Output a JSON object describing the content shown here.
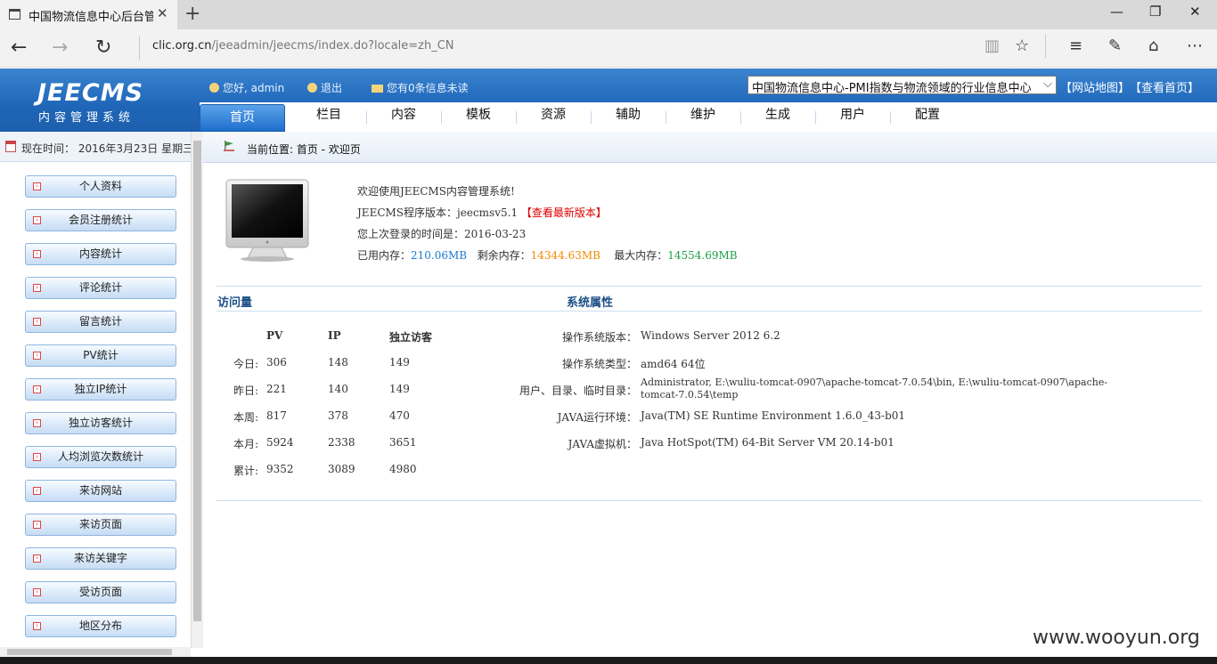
{
  "browser": {
    "tab_title": "中国物流信息中心后台管",
    "new_tab": "+",
    "url_host": "clic.org.cn",
    "url_path": "/jeeadmin/jeecms/index.do?locale=zh_CN",
    "window_controls": [
      "minimize-icon",
      "restore-icon",
      "close-icon"
    ],
    "toolbar_icons": [
      "reading-view-icon",
      "favorite-star-icon",
      "hub-icon",
      "web-note-icon",
      "share-icon",
      "more-icon"
    ]
  },
  "header": {
    "logo_main": "JEECMS",
    "logo_sub": "内容管理系统",
    "greeting": "您好, admin",
    "logout": "退出",
    "messages": "您有0条信息未读",
    "site_select": "中国物流信息中心-PMI指数与物流领域的行业信息中心",
    "site_map": "【网站地图】",
    "view_home": "【查看首页】"
  },
  "nav": {
    "tabs": [
      "首页",
      "栏目",
      "内容",
      "模板",
      "资源",
      "辅助",
      "维护",
      "生成",
      "用户",
      "配置"
    ],
    "active": "首页"
  },
  "sidebar": {
    "time_label": "现在时间：",
    "time_value": "2016年3月23日 星期三",
    "items": [
      "个人资料",
      "会员注册统计",
      "内容统计",
      "评论统计",
      "留言统计",
      "PV统计",
      "独立IP统计",
      "独立访客统计",
      "人均浏览次数统计",
      "来访网站",
      "来访页面",
      "来访关键字",
      "受访页面",
      "地区分布"
    ]
  },
  "location": {
    "label": "当前位置: 首页 - 欢迎页"
  },
  "welcome": {
    "line1": "欢迎使用JEECMS内容管理系统!",
    "version_label": "JEECMS程序版本：",
    "version_value": "jeecmsv5.1",
    "version_link": "【查看最新版本】",
    "last_login_label": "您上次登录的时间是：",
    "last_login_value": "2016-03-23",
    "mem_used_label": "已用内存：",
    "mem_used": "210.06MB",
    "mem_free_label": "剩余内存：",
    "mem_free": "14344.63MB",
    "mem_max_label": "最大内存：",
    "mem_max": "14554.69MB"
  },
  "visits": {
    "title": "访问量",
    "columns": [
      "PV",
      "IP",
      "独立访客"
    ],
    "rows": [
      {
        "label": "今日:",
        "pv": "306",
        "ip": "148",
        "uv": "149"
      },
      {
        "label": "昨日:",
        "pv": "221",
        "ip": "140",
        "uv": "149"
      },
      {
        "label": "本周:",
        "pv": "817",
        "ip": "378",
        "uv": "470"
      },
      {
        "label": "本月:",
        "pv": "5924",
        "ip": "2338",
        "uv": "3651"
      },
      {
        "label": "累计:",
        "pv": "9352",
        "ip": "3089",
        "uv": "4980"
      }
    ]
  },
  "system": {
    "title": "系统属性",
    "rows": [
      {
        "label": "操作系统版本：",
        "value": "Windows Server 2012 6.2"
      },
      {
        "label": "操作系统类型：",
        "value": "amd64 64位"
      },
      {
        "label": "用户、目录、临时目录：",
        "value": "Administrator, E:\\wuliu-tomcat-0907\\apache-tomcat-7.0.54\\bin, E:\\wuliu-tomcat-0907\\apache-",
        "value2": "tomcat-7.0.54\\temp"
      },
      {
        "label": "JAVA运行环境：",
        "value": "Java(TM) SE Runtime Environment 1.6.0_43-b01"
      },
      {
        "label": "JAVA虚拟机：",
        "value": "Java HotSpot(TM) 64-Bit Server VM 20.14-b01"
      }
    ]
  },
  "watermark": "www.wooyun.org",
  "colors": {
    "header_blue": "#1f66b8",
    "link_red": "#d00000",
    "mem_blue": "#1a7ad1",
    "mem_orange": "#f08c00",
    "mem_green": "#1aa045"
  }
}
